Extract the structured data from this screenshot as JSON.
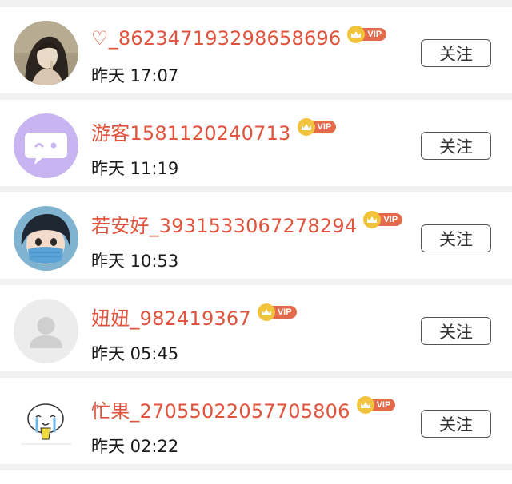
{
  "vip_label": "VIP",
  "follow_label": "关注",
  "colors": {
    "username": "#e0533c",
    "vip_badge": "#e36a4a",
    "crown": "#f2c43d",
    "divider": "#f1f1f1"
  },
  "users": [
    {
      "name": "♡_862347193298658696",
      "time": "昨天 17:07",
      "avatar": "portrait-photo"
    },
    {
      "name": "游客1581120240713",
      "time": "昨天 11:19",
      "avatar": "purple-chat-face"
    },
    {
      "name": "若安好_3931533067278294",
      "time": "昨天 10:53",
      "avatar": "masked-boy-cartoon"
    },
    {
      "name": "妞妞_982419367",
      "time": "昨天 05:45",
      "avatar": "default-placeholder"
    },
    {
      "name": "忙果_27055022057705806",
      "time": "昨天 02:22",
      "avatar": "crying-cartoon-sticker"
    }
  ]
}
